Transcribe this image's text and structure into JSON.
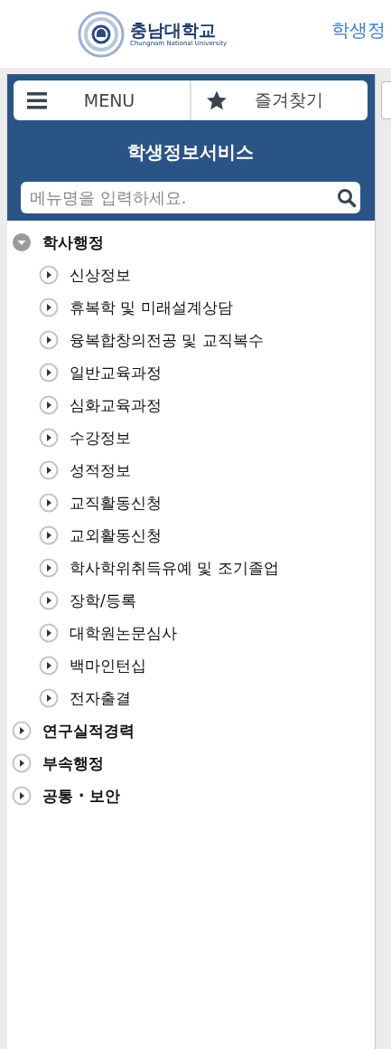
{
  "header": {
    "logo_name": "충남대학교",
    "logo_subtitle": "Chungnam National University",
    "title": "학생정"
  },
  "sidebar": {
    "tabs": [
      {
        "label": "MENU",
        "kind": "menu",
        "selected": false
      },
      {
        "label": "즐겨찾기",
        "kind": "star",
        "selected": false
      }
    ],
    "title": "학생정보서비스",
    "search": {
      "placeholder": "메뉴명을 입력하세요."
    },
    "tree": [
      {
        "label": "학사행정",
        "expanded": true,
        "children": [
          {
            "label": "신상정보",
            "expanded": false
          },
          {
            "label": "휴복학 및 미래설계상담",
            "expanded": false
          },
          {
            "label": "융복합창의전공 및 교직복수",
            "expanded": false
          },
          {
            "label": "일반교육과정",
            "expanded": false
          },
          {
            "label": "심화교육과정",
            "expanded": false
          },
          {
            "label": "수강정보",
            "expanded": false
          },
          {
            "label": "성적정보",
            "expanded": false
          },
          {
            "label": "교직활동신청",
            "expanded": false
          },
          {
            "label": "교외활동신청",
            "expanded": false
          },
          {
            "label": "학사학위취득유예 및 조기졸업",
            "expanded": false
          },
          {
            "label": "장학/등록",
            "expanded": false
          },
          {
            "label": "대학원논문심사",
            "expanded": false
          },
          {
            "label": "백마인턴십",
            "expanded": false
          },
          {
            "label": "전자출결",
            "expanded": false
          }
        ]
      },
      {
        "label": "연구실적경력",
        "expanded": false
      },
      {
        "label": "부속행정",
        "expanded": false
      },
      {
        "label": "공통 · 보안",
        "expanded": false
      }
    ]
  }
}
